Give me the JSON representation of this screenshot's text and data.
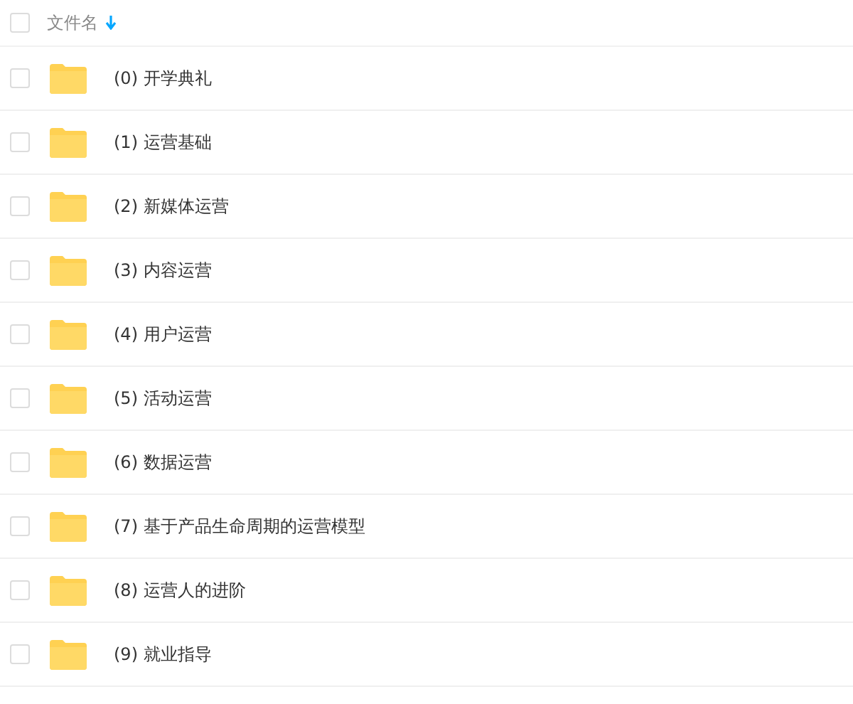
{
  "header": {
    "checked": false,
    "column": "文件名",
    "sorted_descending": true
  },
  "rows": [
    {
      "name": "(0) 开学典礼",
      "checked": false
    },
    {
      "name": "(1) 运营基础",
      "checked": false
    },
    {
      "name": "(2) 新媒体运营",
      "checked": false
    },
    {
      "name": "(3) 内容运营",
      "checked": false
    },
    {
      "name": "(4) 用户运营",
      "checked": false
    },
    {
      "name": "(5) 活动运营",
      "checked": false
    },
    {
      "name": "(6) 数据运营",
      "checked": false
    },
    {
      "name": "(7) 基于产品生命周期的运营模型",
      "checked": false
    },
    {
      "name": "(8) 运营人的进阶",
      "checked": false
    },
    {
      "name": "(9) 就业指导",
      "checked": false
    }
  ]
}
